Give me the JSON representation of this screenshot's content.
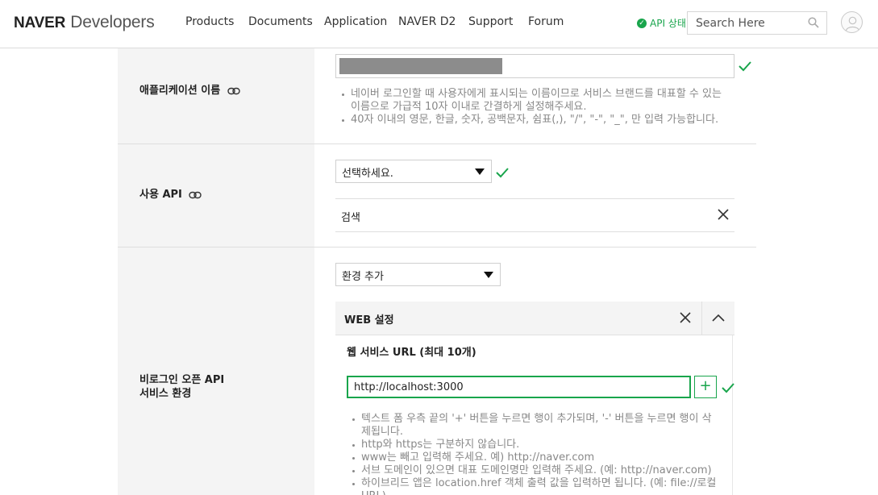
{
  "header": {
    "logo_brand": "NAVER",
    "logo_product": "Developers",
    "nav": [
      "Products",
      "Documents",
      "Application",
      "NAVER D2",
      "Support",
      "Forum"
    ],
    "api_status": "API 상태",
    "search_placeholder": "Search Here"
  },
  "form": {
    "app_name": {
      "label": "애플리케이션 이름",
      "bullets": [
        "네이버 로그인할 때 사용자에게 표시되는 이름이므로 서비스 브랜드를 대표할 수 있는 이름으로 가급적 10자 이내로 간결하게 설정해주세요.",
        "40자 이내의 영문, 한글, 숫자, 공백문자, 쉼표(,), \"/\", \"-\", \"_\", 만 입력 가능합니다."
      ]
    },
    "api": {
      "label": "사용 API",
      "select_value": "선택하세요.",
      "items": [
        "검색"
      ]
    },
    "env": {
      "label_line1": "비로그인 오픈 API",
      "label_line2": "서비스 환경",
      "select_value": "환경 추가",
      "web": {
        "title": "WEB 설정",
        "url_title": "웹 서비스 URL (최대 10개)",
        "url_value": "http://localhost:3000",
        "plus_label": "+",
        "bullets": [
          "텍스트 폼 우측 끝의 '+' 버튼을 누르면 행이 추가되며, '-' 버튼을 누르면 행이 삭제됩니다.",
          "http와 https는 구분하지 않습니다.",
          "www는 빼고 입력해 주세요. 예) http://naver.com",
          "서브 도메인이 있으면 대표 도메인명만 입력해 주세요. (예: http://naver.com)",
          "하이브리드 앱은 location.href 객체 출력 값을 입력하면 됩니다. (예: file://로컬URL)"
        ]
      }
    }
  },
  "colors": {
    "accent": "#19a54c",
    "label_bg": "#f4f4f4",
    "border": "#dedede"
  }
}
